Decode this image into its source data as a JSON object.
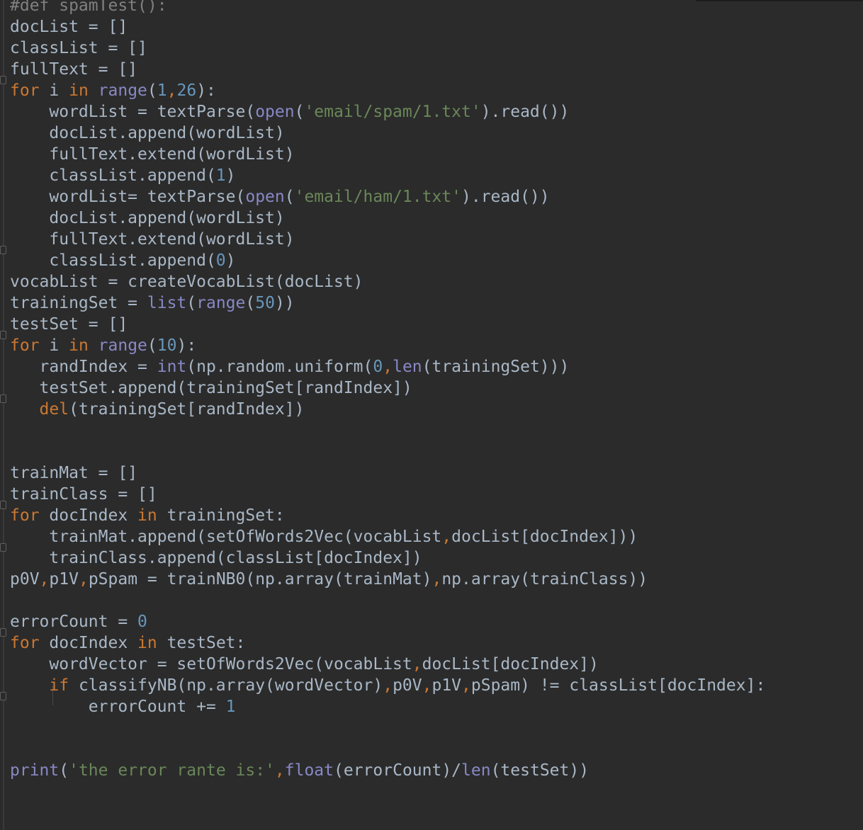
{
  "editor": {
    "language": "python",
    "theme_colors": {
      "background": "#2b2b2b",
      "default": "#a9b7c6",
      "keyword": "#cc7832",
      "builtin": "#8888c6",
      "number": "#6897bb",
      "string": "#6a8759",
      "comment": "#808080"
    },
    "lines": [
      [
        [
          "c",
          "#def spamTest():"
        ]
      ],
      [
        [
          "d",
          "docList = []"
        ]
      ],
      [
        [
          "d",
          "classList = []"
        ]
      ],
      [
        [
          "d",
          "fullText = []"
        ]
      ],
      [
        [
          "k",
          "for"
        ],
        [
          "d",
          " i "
        ],
        [
          "k",
          "in"
        ],
        [
          "d",
          " "
        ],
        [
          "b",
          "range"
        ],
        [
          "d",
          "("
        ],
        [
          "n",
          "1"
        ],
        [
          "k",
          ","
        ],
        [
          "n",
          "26"
        ],
        [
          "d",
          "):"
        ]
      ],
      [
        [
          "d",
          "    wordList = textParse("
        ],
        [
          "b",
          "open"
        ],
        [
          "d",
          "("
        ],
        [
          "s",
          "'email/spam/1.txt'"
        ],
        [
          "d",
          ").read())"
        ]
      ],
      [
        [
          "d",
          "    docList.append(wordList)"
        ]
      ],
      [
        [
          "d",
          "    fullText.extend(wordList)"
        ]
      ],
      [
        [
          "d",
          "    classList.append("
        ],
        [
          "n",
          "1"
        ],
        [
          "d",
          ")"
        ]
      ],
      [
        [
          "d",
          "    wordList= textParse("
        ],
        [
          "b",
          "open"
        ],
        [
          "d",
          "("
        ],
        [
          "s",
          "'email/ham/1.txt'"
        ],
        [
          "d",
          ").read())"
        ]
      ],
      [
        [
          "d",
          "    docList.append(wordList)"
        ]
      ],
      [
        [
          "d",
          "    fullText.extend(wordList)"
        ]
      ],
      [
        [
          "d",
          "    classList.append("
        ],
        [
          "n",
          "0"
        ],
        [
          "d",
          ")"
        ]
      ],
      [
        [
          "d",
          "vocabList = createVocabList(docList)"
        ]
      ],
      [
        [
          "d",
          "trainingSet = "
        ],
        [
          "b",
          "list"
        ],
        [
          "d",
          "("
        ],
        [
          "b",
          "range"
        ],
        [
          "d",
          "("
        ],
        [
          "n",
          "50"
        ],
        [
          "d",
          "))"
        ]
      ],
      [
        [
          "d",
          "testSet = []"
        ]
      ],
      [
        [
          "k",
          "for"
        ],
        [
          "d",
          " i "
        ],
        [
          "k",
          "in"
        ],
        [
          "d",
          " "
        ],
        [
          "b",
          "range"
        ],
        [
          "d",
          "("
        ],
        [
          "n",
          "10"
        ],
        [
          "d",
          "):"
        ]
      ],
      [
        [
          "d",
          "   randIndex = "
        ],
        [
          "b",
          "int"
        ],
        [
          "d",
          "(np.random.uniform("
        ],
        [
          "n",
          "0"
        ],
        [
          "k",
          ","
        ],
        [
          "b",
          "len"
        ],
        [
          "d",
          "(trainingSet)))"
        ]
      ],
      [
        [
          "d",
          "   testSet.append(trainingSet[randIndex])"
        ]
      ],
      [
        [
          "d",
          "   "
        ],
        [
          "k",
          "del"
        ],
        [
          "d",
          "(trainingSet[randIndex])"
        ]
      ],
      [
        [
          "d",
          ""
        ]
      ],
      [
        [
          "d",
          ""
        ]
      ],
      [
        [
          "d",
          "trainMat = []"
        ]
      ],
      [
        [
          "d",
          "trainClass = []"
        ]
      ],
      [
        [
          "k",
          "for"
        ],
        [
          "d",
          " docIndex "
        ],
        [
          "k",
          "in"
        ],
        [
          "d",
          " trainingSet:"
        ]
      ],
      [
        [
          "d",
          "    trainMat.append(setOfWords2Vec(vocabList"
        ],
        [
          "k",
          ","
        ],
        [
          "d",
          "docList[docIndex]))"
        ]
      ],
      [
        [
          "d",
          "    trainClass.append(classList[docIndex])"
        ]
      ],
      [
        [
          "d",
          "p0V"
        ],
        [
          "k",
          ","
        ],
        [
          "d",
          "p1V"
        ],
        [
          "k",
          ","
        ],
        [
          "d",
          "pSpam = trainNB0(np.array(trainMat)"
        ],
        [
          "k",
          ","
        ],
        [
          "d",
          "np.array(trainClass))"
        ]
      ],
      [
        [
          "d",
          ""
        ]
      ],
      [
        [
          "d",
          "errorCount = "
        ],
        [
          "n",
          "0"
        ]
      ],
      [
        [
          "k",
          "for"
        ],
        [
          "d",
          " docIndex "
        ],
        [
          "k",
          "in"
        ],
        [
          "d",
          " testSet:"
        ]
      ],
      [
        [
          "d",
          "    wordVector = setOfWords2Vec(vocabList"
        ],
        [
          "k",
          ","
        ],
        [
          "d",
          "docList[docIndex])"
        ]
      ],
      [
        [
          "d",
          "    "
        ],
        [
          "k",
          "if"
        ],
        [
          "d",
          " classifyNB(np.array(wordVector)"
        ],
        [
          "k",
          ","
        ],
        [
          "d",
          "p0V"
        ],
        [
          "k",
          ","
        ],
        [
          "d",
          "p1V"
        ],
        [
          "k",
          ","
        ],
        [
          "d",
          "pSpam) != classList[docIndex]:"
        ]
      ],
      [
        [
          "d",
          "        errorCount += "
        ],
        [
          "n",
          "1"
        ]
      ],
      [
        [
          "d",
          ""
        ]
      ],
      [
        [
          "d",
          ""
        ]
      ],
      [
        [
          "b",
          "print"
        ],
        [
          "d",
          "("
        ],
        [
          "s",
          "'the error rante is:'"
        ],
        [
          "k",
          ","
        ],
        [
          "b",
          "float"
        ],
        [
          "d",
          "(errorCount)/"
        ],
        [
          "b",
          "len"
        ],
        [
          "d",
          "(testSet))"
        ]
      ]
    ]
  }
}
